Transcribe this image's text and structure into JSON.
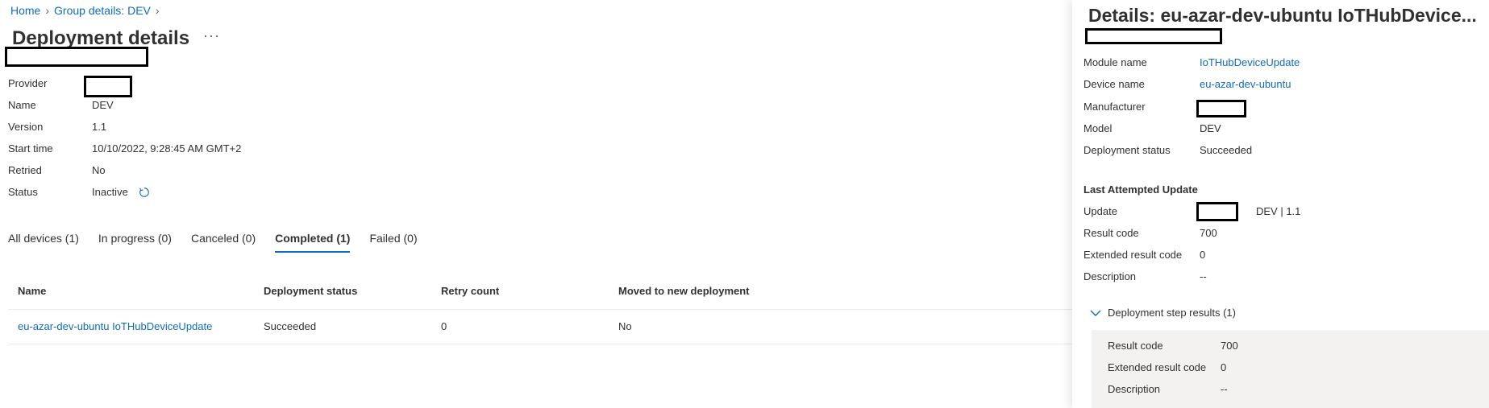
{
  "breadcrumb": {
    "home": "Home",
    "group": "Group details: DEV"
  },
  "page": {
    "title": "Deployment details",
    "more": "···"
  },
  "properties": [
    {
      "key": "Provider",
      "value": ""
    },
    {
      "key": "Name",
      "value": "DEV"
    },
    {
      "key": "Version",
      "value": "1.1"
    },
    {
      "key": "Start time",
      "value": "10/10/2022, 9:28:45 AM GMT+2"
    },
    {
      "key": "Retried",
      "value": "No"
    },
    {
      "key": "Status",
      "value": "Inactive"
    }
  ],
  "tabs": [
    {
      "label": "All devices (1)"
    },
    {
      "label": "In progress (0)"
    },
    {
      "label": "Canceled (0)"
    },
    {
      "label": "Completed (1)",
      "active": true
    },
    {
      "label": "Failed (0)"
    }
  ],
  "table": {
    "columns": [
      "Name",
      "Deployment status",
      "Retry count",
      "Moved to new deployment"
    ],
    "rows": [
      [
        "eu-azar-dev-ubuntu IoTHubDeviceUpdate",
        "Succeeded",
        "0",
        "No"
      ]
    ]
  },
  "details": {
    "title": "Details: eu-azar-dev-ubuntu IoTHubDevice...",
    "fields": [
      {
        "key": "Module name",
        "value": "IoTHubDeviceUpdate"
      },
      {
        "key": "Device name",
        "value": "eu-azar-dev-ubuntu"
      },
      {
        "key": "Manufacturer",
        "value": ""
      },
      {
        "key": "Model",
        "value": "DEV"
      },
      {
        "key": "Deployment status",
        "value": "Succeeded"
      }
    ],
    "last_update_title": "Last Attempted Update",
    "update_fields": [
      {
        "key": "Update",
        "value": "DEV | 1.1"
      },
      {
        "key": "Result code",
        "value": "700"
      },
      {
        "key": "Extended result code",
        "value": "0"
      },
      {
        "key": "Description",
        "value": "--"
      }
    ],
    "step_results_label": "Deployment step results (1)",
    "step_fields": [
      {
        "key": "Result code",
        "value": "700"
      },
      {
        "key": "Extended result code",
        "value": "0"
      },
      {
        "key": "Description",
        "value": "--"
      }
    ]
  },
  "colors": {
    "accent": "#0f6cbd",
    "text": "#323130",
    "muted": "#605e5c",
    "panel_bg": "#f3f2f1"
  },
  "icons": {
    "refresh": "refresh-icon",
    "chevron": "chevron-right-icon",
    "expander": "chevron-down-icon",
    "more": "more-icon"
  }
}
